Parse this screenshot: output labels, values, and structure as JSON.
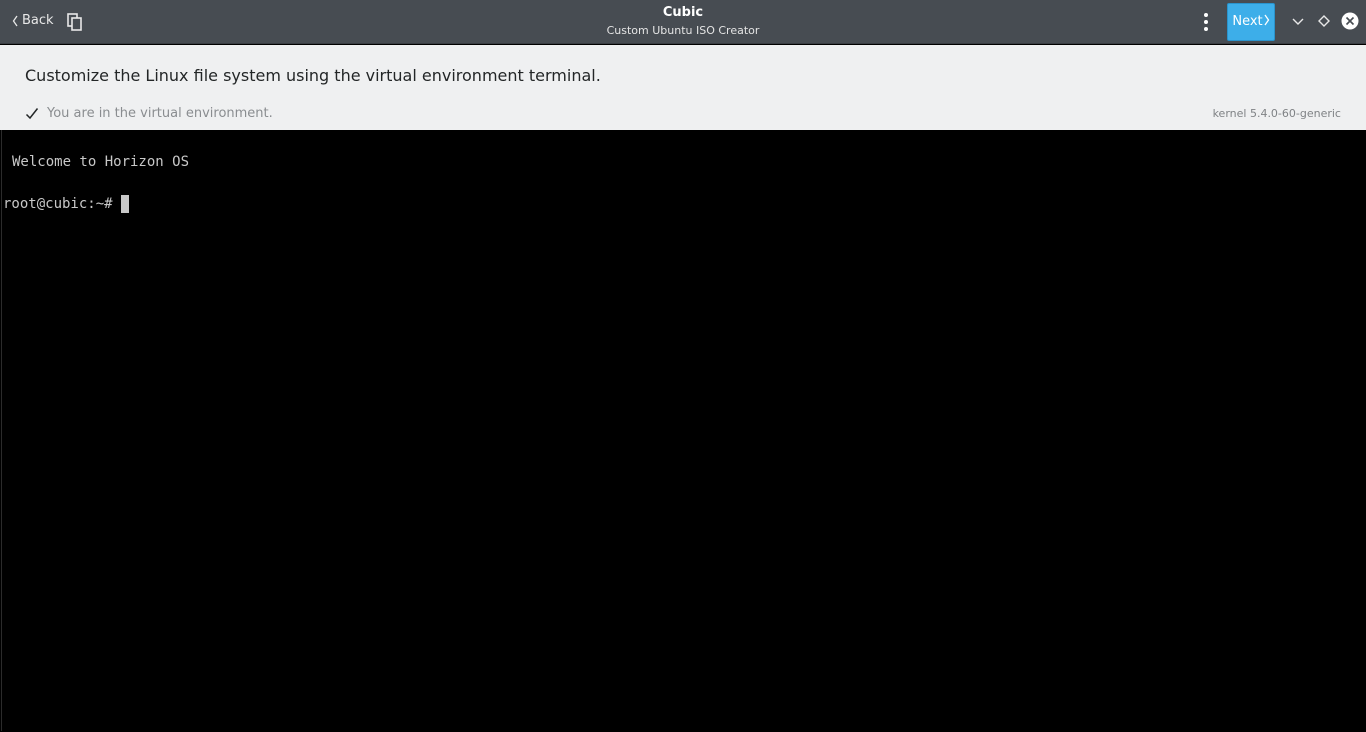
{
  "titlebar": {
    "back_label": "Back",
    "title": "Cubic",
    "subtitle": "Custom Ubuntu ISO Creator",
    "next_label": "Next"
  },
  "header": {
    "instruction": "Customize the Linux file system using the virtual environment terminal.",
    "status": "You are in the virtual environment.",
    "kernel": "kernel 5.4.0-60-generic"
  },
  "terminal": {
    "welcome": "Welcome to Horizon OS",
    "prompt": "root@cubic:~#"
  },
  "colors": {
    "titlebar_bg": "#474c52",
    "accent": "#3daee9",
    "header_bg": "#eff0f1",
    "terminal_bg": "#000000"
  },
  "icons": [
    "chevron-left-icon",
    "copy-icon",
    "kebab-menu-icon",
    "chevron-right-icon",
    "minimize-icon",
    "maximize-icon",
    "close-icon",
    "checkmark-icon"
  ]
}
